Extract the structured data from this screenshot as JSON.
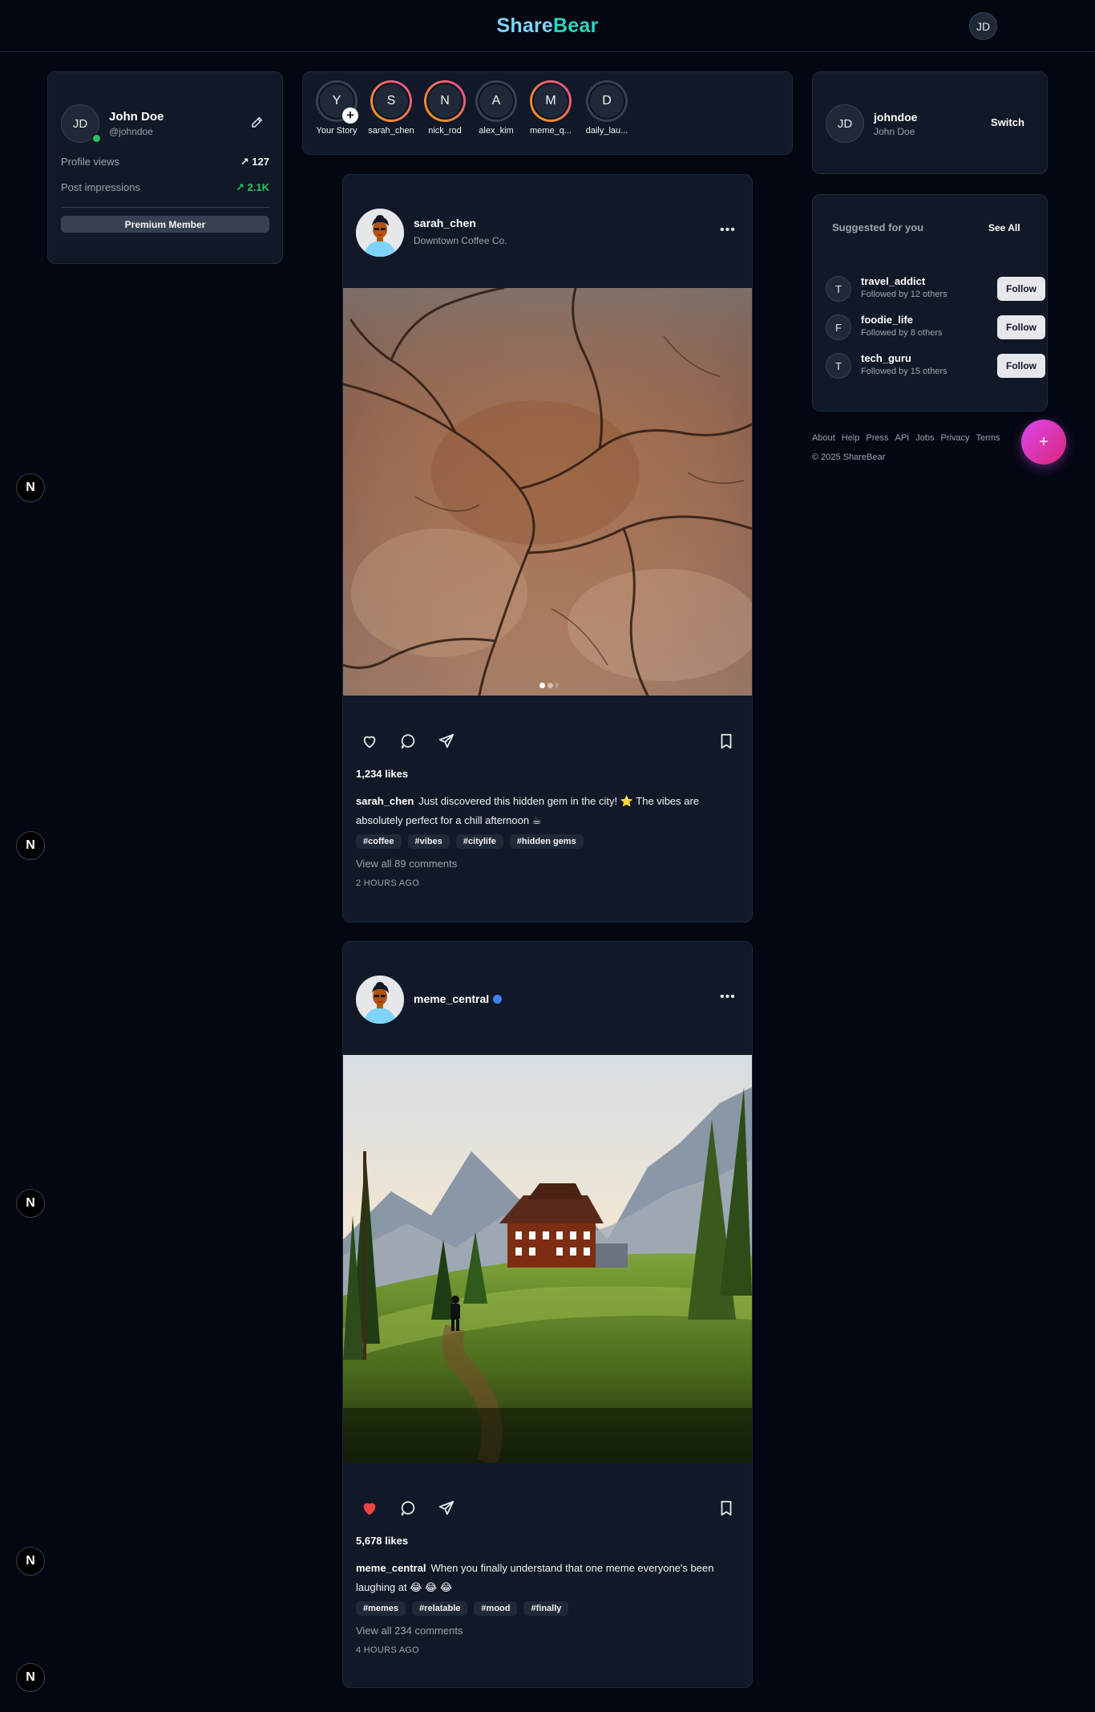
{
  "header": {
    "logo_part1": "Share",
    "logo_part2": "Bear",
    "avatar_initials": "JD"
  },
  "profile": {
    "initials": "JD",
    "name": "John Doe",
    "handle": "@johndoe",
    "stats": [
      {
        "label": "Profile views",
        "value": "127"
      },
      {
        "label": "Post impressions",
        "value": "2.1K"
      }
    ],
    "badge": "Premium Member"
  },
  "stories": [
    {
      "initial": "Y",
      "label": "Your Story"
    },
    {
      "initial": "S",
      "label": "sarah_chen"
    },
    {
      "initial": "N",
      "label": "nick_rod"
    },
    {
      "initial": "A",
      "label": "alex_kim"
    },
    {
      "initial": "M",
      "label": "meme_q..."
    },
    {
      "initial": "D",
      "label": "daily_lau..."
    }
  ],
  "posts": [
    {
      "username": "sarah_chen",
      "location": "Downtown Coffee Co.",
      "likes": "1,234 likes",
      "caption_user": "sarah_chen",
      "caption_text": "Just discovered this hidden gem in the city! ⭐ The vibes are absolutely perfect for a chill afternoon ☕",
      "tags": [
        "#coffee",
        "#vibes",
        "#citylife",
        "#hidden gems"
      ],
      "comments": "View all 89 comments",
      "time": "2 HOURS AGO",
      "liked": false
    },
    {
      "username": "meme_central",
      "location": "",
      "likes": "5,678 likes",
      "caption_user": "meme_central",
      "caption_text": "When you finally understand that one meme everyone's been laughing at 😂 😂 😂",
      "tags": [
        "#memes",
        "#relatable",
        "#mood",
        "#finally"
      ],
      "comments": "View all 234 comments",
      "time": "4 HOURS AGO",
      "liked": true
    }
  ],
  "account": {
    "initials": "JD",
    "username": "johndoe",
    "name": "John Doe",
    "switch_label": "Switch"
  },
  "suggestions": {
    "title": "Suggested for you",
    "see_all": "See All",
    "items": [
      {
        "initial": "T",
        "username": "travel_addict",
        "sub": "Followed by 12 others",
        "button": "Follow"
      },
      {
        "initial": "F",
        "username": "foodie_life",
        "sub": "Followed by 8 others",
        "button": "Follow"
      },
      {
        "initial": "T",
        "username": "tech_guru",
        "sub": "Followed by 15 others",
        "button": "Follow"
      }
    ]
  },
  "footer": {
    "links": [
      "About",
      "Help",
      "Press",
      "API",
      "Jobs",
      "Privacy",
      "Terms"
    ],
    "copyright": "© 2025 ShareBear"
  },
  "fab_label": "+",
  "dev_badge": "N",
  "colors": {
    "background": "#030712",
    "card": "#111827",
    "accent": "#d946ef",
    "like": "#ef4444",
    "online": "#22c55e",
    "verified": "#3b82f6"
  }
}
